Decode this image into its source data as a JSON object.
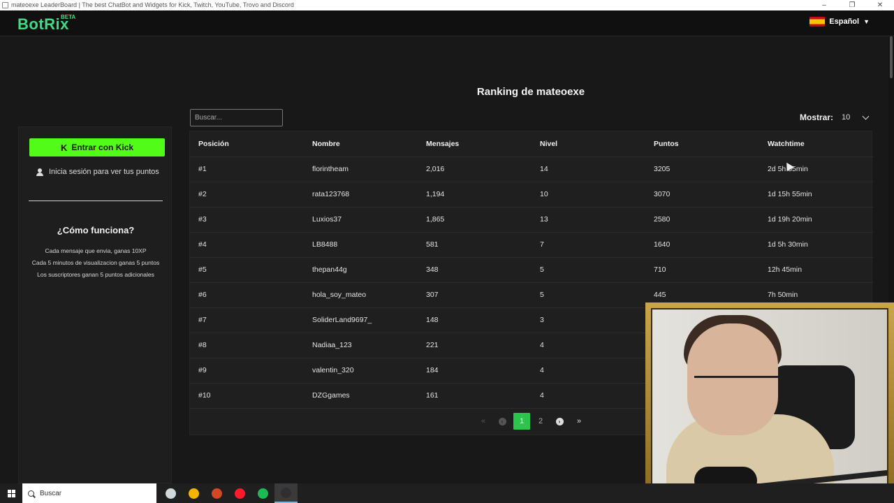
{
  "window": {
    "title": "mateoexe LeaderBoard | The best ChatBot and Widgets for Kick, Twitch, YouTube, Trovo and Discord",
    "controls": [
      "–",
      "❐",
      "✕"
    ]
  },
  "navbar": {
    "logo": "BotRix",
    "logo_badge": "BETA",
    "language": "Español"
  },
  "sidebar": {
    "login_button": "Entrar con Kick",
    "login_hint": "Inicia sesión para ver tus puntos",
    "how_title": "¿Cómo funciona?",
    "rules": [
      "Cada mensaje que envia, ganas 10XP",
      "Cada 5 minutos de visualizacion ganas 5 puntos",
      "Los suscriptores ganan 5 puntos adicionales"
    ]
  },
  "main": {
    "title": "Ranking de mateoexe",
    "search_placeholder": "Buscar...",
    "show_label": "Mostrar:",
    "show_value": "10",
    "columns": [
      "Posición",
      "Nombre",
      "Mensajes",
      "Nivel",
      "Puntos",
      "Watchtime"
    ],
    "rows": [
      [
        "#1",
        "florintheam",
        "2,016",
        "14",
        "3205",
        "2d 5h 55min"
      ],
      [
        "#2",
        "rata123768",
        "1,194",
        "10",
        "3070",
        "1d 15h 55min"
      ],
      [
        "#3",
        "Luxios37",
        "1,865",
        "13",
        "2580",
        "1d 19h 20min"
      ],
      [
        "#4",
        "LB8488",
        "581",
        "7",
        "1640",
        "1d 5h 30min"
      ],
      [
        "#5",
        "thepan44g",
        "348",
        "5",
        "710",
        "12h 45min"
      ],
      [
        "#6",
        "hola_soy_mateo",
        "307",
        "5",
        "445",
        "7h 50min"
      ],
      [
        "#7",
        "SoliderLand9697_",
        "148",
        "3",
        "",
        ""
      ],
      [
        "#8",
        "Nadiaa_123",
        "221",
        "4",
        "",
        ""
      ],
      [
        "#9",
        "valentin_320",
        "184",
        "4",
        "",
        ""
      ],
      [
        "#10",
        "DZGgames",
        "161",
        "4",
        "",
        ""
      ]
    ],
    "pagination": {
      "first": "«",
      "prev": "‹",
      "pages": [
        "1",
        "2"
      ],
      "current": "1",
      "next": "›",
      "last": "»"
    }
  },
  "taskbar": {
    "search_placeholder": "Buscar",
    "apps": [
      {
        "name": "app-icon",
        "color": "#cfd8dc"
      },
      {
        "name": "chrome-icon",
        "color": "#f4b400"
      },
      {
        "name": "powerpoint-icon",
        "color": "#d24726"
      },
      {
        "name": "opera-icon",
        "color": "#ff1b2d"
      },
      {
        "name": "spotify-icon",
        "color": "#1db954"
      },
      {
        "name": "obs-icon",
        "color": "#302e31"
      }
    ]
  },
  "colors": {
    "brand": "#3ddc84",
    "kick_green": "#53fc18",
    "active_page": "#2bc44c"
  }
}
